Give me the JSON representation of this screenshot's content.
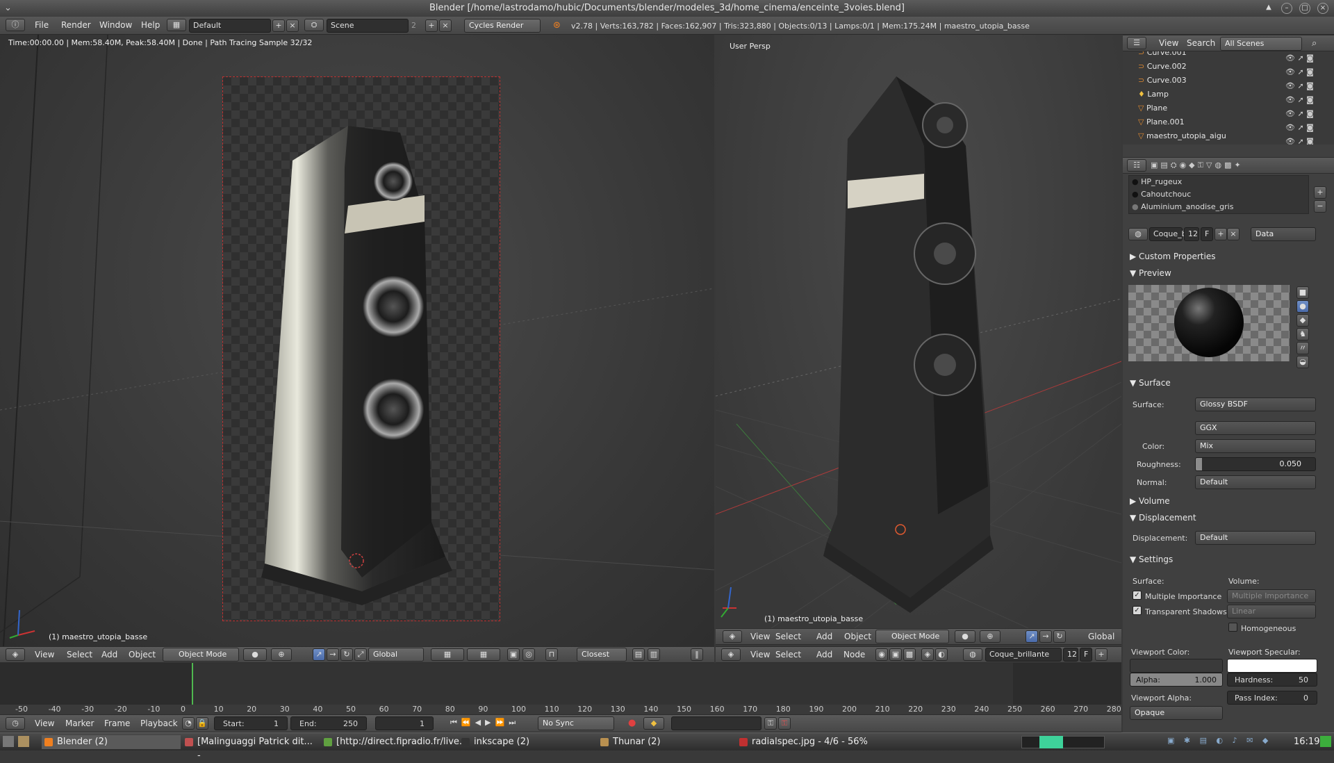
{
  "window": {
    "title": "Blender [/home/lastrodamo/hubic/Documents/blender/modeles_3d/home_cinema/enceinte_3voies.blend]"
  },
  "info": {
    "menus": [
      "File",
      "Render",
      "Window",
      "Help"
    ],
    "screen": "Default",
    "scene": "Scene",
    "scene_num": "2",
    "engine": "Cycles Render",
    "stats": "v2.78 | Verts:163,782 | Faces:162,907 | Tris:323,880 | Objects:0/13 | Lamps:0/1 | Mem:175.24M | maestro_utopia_basse"
  },
  "left_viewport": {
    "status": "Time:00:00.00 | Mem:58.40M, Peak:58.40M | Done | Path Tracing Sample 32/32",
    "object_label": "(1) maestro_utopia_basse",
    "header": {
      "menus": [
        "View",
        "Select",
        "Add",
        "Object"
      ],
      "mode": "Object Mode",
      "orientation": "Global",
      "snap": "Closest"
    }
  },
  "right_viewport": {
    "view_label": "User Persp",
    "object_label": "(1) maestro_utopia_basse",
    "header": {
      "menus": [
        "View",
        "Select",
        "Add",
        "Object"
      ],
      "mode": "Object Mode",
      "orientation": "Global"
    },
    "node_header": {
      "menus": [
        "View",
        "Select",
        "Add",
        "Node"
      ],
      "material": "Coque_brillante",
      "users": "12",
      "fake": "F"
    }
  },
  "outliner": {
    "view": "View",
    "search": "Search",
    "filter": "All Scenes",
    "items": [
      "Curve.001",
      "Curve.002",
      "Curve.003",
      "Lamp",
      "Plane",
      "Plane.001",
      "maestro_utopia_aigu"
    ]
  },
  "properties": {
    "material_slots": [
      "HP_rugeux",
      "Cahoutchouc",
      "Aluminium_anodise_gris"
    ],
    "material_name": "Coque_b",
    "material_users": "12",
    "fake": "F",
    "link": "Data",
    "sections": {
      "custom": "Custom Properties",
      "preview": "Preview",
      "surface": "Surface",
      "volume": "Volume",
      "displacement": "Displacement",
      "settings": "Settings"
    },
    "surface": {
      "label": "Surface:",
      "value": "Glossy BSDF",
      "distribution": "GGX",
      "color_label": "Color:",
      "color_value": "Mix",
      "roughness_label": "Roughness:",
      "roughness_value": "0.050",
      "roughness": 0.05,
      "normal_label": "Normal:",
      "normal_value": "Default"
    },
    "displacement": {
      "label": "Displacement:",
      "value": "Default"
    },
    "settings": {
      "surface_label": "Surface:",
      "volume_label": "Volume:",
      "multiple_importance": "Multiple Importance",
      "transparent_shadows": "Transparent Shadows",
      "vol_sampling": "Multiple Importance",
      "vol_interp": "Linear",
      "homogeneous": "Homogeneous",
      "viewport_color": "Viewport Color:",
      "viewport_specular": "Viewport Specular:",
      "alpha_label": "Alpha:",
      "alpha_value": "1.000",
      "hardness_label": "Hardness:",
      "hardness_value": "50",
      "viewport_alpha": "Viewport Alpha:",
      "pass_index_label": "Pass Index:",
      "pass_index_value": "0",
      "blend": "Opaque"
    }
  },
  "timeline": {
    "ticks": [
      "-50",
      "-40",
      "-30",
      "-20",
      "-10",
      "0",
      "10",
      "20",
      "30",
      "40",
      "50",
      "60",
      "70",
      "80",
      "90",
      "100",
      "110",
      "120",
      "130",
      "140",
      "150",
      "160",
      "170",
      "180",
      "190",
      "200",
      "210",
      "220",
      "230",
      "240",
      "250",
      "260",
      "270",
      "280"
    ],
    "menus": [
      "View",
      "Marker",
      "Frame",
      "Playback"
    ],
    "start_label": "Start:",
    "start": "1",
    "end_label": "End:",
    "end": "250",
    "current": "1",
    "sync": "No Sync"
  },
  "taskbar": {
    "items": [
      "Blender (2)",
      "[Malinguaggi Patrick dit... -",
      "[http://direct.fipradio.fr/live...",
      "inkscape (2)",
      "Thunar (2)",
      "radialspec.jpg - 4/6 - 56%"
    ],
    "clock": "16:19"
  }
}
